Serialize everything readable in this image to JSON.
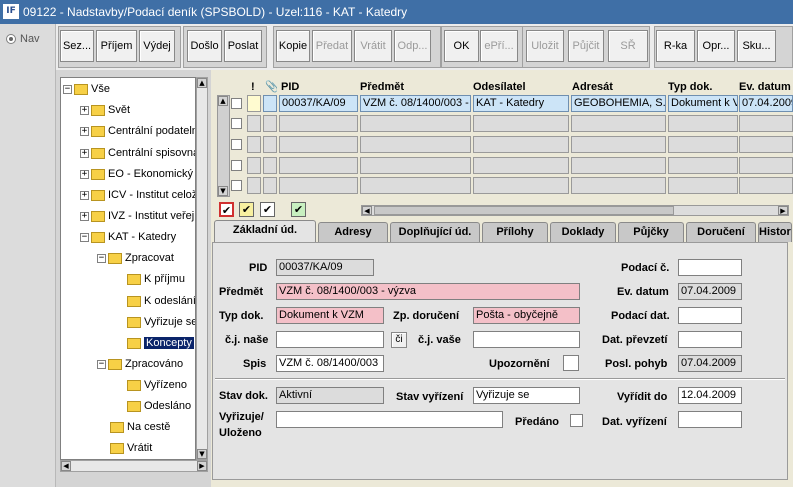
{
  "title": "09122 - Nadstavby/Podací deník (SPSBOLD) - Uzel:116 - KAT - Katedry",
  "logo": "IF",
  "nav_label": "Nav",
  "toolbar": {
    "b1": "Sez...",
    "b2": "Příjem",
    "b3": "Výdej",
    "b4": "Došlo",
    "b5": "Poslat",
    "b6": "Kopie",
    "b7": "Předat",
    "b8": "Vrátit",
    "b9": "Odp...",
    "b10": "OK",
    "b11": "ePří...",
    "b12": "Uložit",
    "b13": "Půjčit",
    "b14": "SŘ",
    "b15": "R-ka",
    "b16": "Opr...",
    "b17": "Sku..."
  },
  "tree": {
    "n0": "Vše",
    "n1": "Svět",
    "n2": "Centrální podatelna",
    "n3": "Centrální spisovna",
    "n4": "EO - Ekonomický odbor",
    "n5": "ICV - Institut celoživotního vzdělávání",
    "n6": "IVZ - Institut veřejné",
    "n7": "KAT - Katedry",
    "n8": "Zpracovat",
    "n9": "K příjmu",
    "n10": "K odeslání",
    "n11": "Vyřizuje se",
    "n12": "Koncepty",
    "n13": "Zpracováno",
    "n14": "Vyřízeno",
    "n15": "Odesláno",
    "n16": "Na cestě",
    "n17": "Vrátit"
  },
  "grid": {
    "h_excl": "!",
    "h_clip": "📎",
    "h_pid": "PID",
    "h_predmet": "Předmět",
    "h_odes": "Odesílatel",
    "h_adresat": "Adresát",
    "h_typ": "Typ dok.",
    "h_evd": "Ev. datum",
    "row1": {
      "pid": "00037/KA/09",
      "predmet": "VZM č. 08/1400/003 - výzva",
      "odes": "KAT - Katedry",
      "adresat": "GEOBOHEMIA, S.R.O.",
      "typ": "Dokument k VZM",
      "evd": "07.04.2009"
    }
  },
  "flags": {
    "f1": "✔",
    "f2": "✔",
    "f3": "✔",
    "f4": "✔"
  },
  "tabs": {
    "t1": "Základní úd.",
    "t2": "Adresy",
    "t3": "Doplňující úd.",
    "t4": "Přílohy",
    "t5": "Doklady",
    "t6": "Půjčky",
    "t7": "Doručení",
    "t8": "Historie"
  },
  "form": {
    "l_pid": "PID",
    "pid": "00037/KA/09",
    "l_podc": "Podací č.",
    "podc": "",
    "l_predmet": "Předmět",
    "predmet": "VZM č. 08/1400/003 - výzva",
    "l_evd": "Ev. datum",
    "evd": "07.04.2009",
    "l_typ": "Typ dok.",
    "typ": "Dokument k VZM",
    "l_zpdor": "Zp. doručení",
    "zpdor": "Pošta - obyčejně",
    "l_poddat": "Podací dat.",
    "poddat": "",
    "l_cjn": "č.j. naše",
    "cjn": "",
    "cjbtn": "či",
    "l_cjv": "č.j. vaše",
    "cjv": "",
    "l_datprev": "Dat. převzetí",
    "datprev": "",
    "l_spis": "Spis",
    "spis": "VZM č. 08/1400/003",
    "l_upoz": "Upozornění",
    "l_posl": "Posl. pohyb",
    "posl": "07.04.2009",
    "l_stav": "Stav dok.",
    "stav": "Aktivní",
    "l_stavv": "Stav vyřízení",
    "stavv": "Vyřizuje se",
    "l_vyrdo": "Vyřídit do",
    "vyrdo": "12.04.2009",
    "l_vyr1": "Vyřizuje/",
    "l_vyr2": "Uloženo",
    "vyr": "",
    "l_pred": "Předáno",
    "l_datvyr": "Dat. vyřízení",
    "datvyr": ""
  },
  "colors": {
    "titlebar": "#3f6fa6",
    "selection": "#0a246a",
    "pink": "#f4c0c8",
    "active_row": "#cce4f7"
  }
}
